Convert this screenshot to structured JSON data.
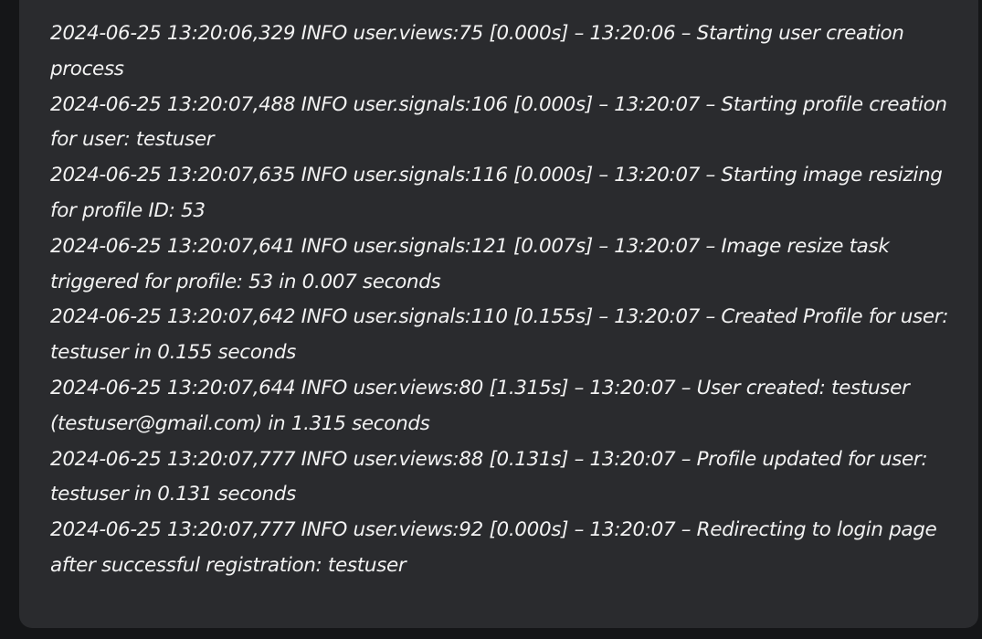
{
  "log": {
    "lines": [
      "2024-06-25 13:20:06,329 INFO user.views:75 [0.000s] – 13:20:06 – Starting user creation process",
      "2024-06-25 13:20:07,488 INFO user.signals:106 [0.000s] – 13:20:07 – Starting profile creation for user: testuser",
      "2024-06-25 13:20:07,635 INFO user.signals:116 [0.000s] – 13:20:07 – Starting image resizing for profile ID: 53",
      "2024-06-25 13:20:07,641 INFO user.signals:121 [0.007s] – 13:20:07 – Image resize task triggered for profile: 53 in 0.007 seconds",
      "2024-06-25 13:20:07,642 INFO user.signals:110 [0.155s] – 13:20:07 – Created Profile for user: testuser in 0.155 seconds",
      "2024-06-25 13:20:07,644 INFO user.views:80 [1.315s] – 13:20:07 – User created: testuser (testuser@gmail.com) in 1.315 seconds",
      "2024-06-25 13:20:07,777 INFO user.views:88 [0.131s] – 13:20:07 – Profile updated for user: testuser in 0.131 seconds",
      "2024-06-25 13:20:07,777 INFO user.views:92 [0.000s] – 13:20:07 – Redirecting to login page after successful registration: testuser"
    ]
  }
}
